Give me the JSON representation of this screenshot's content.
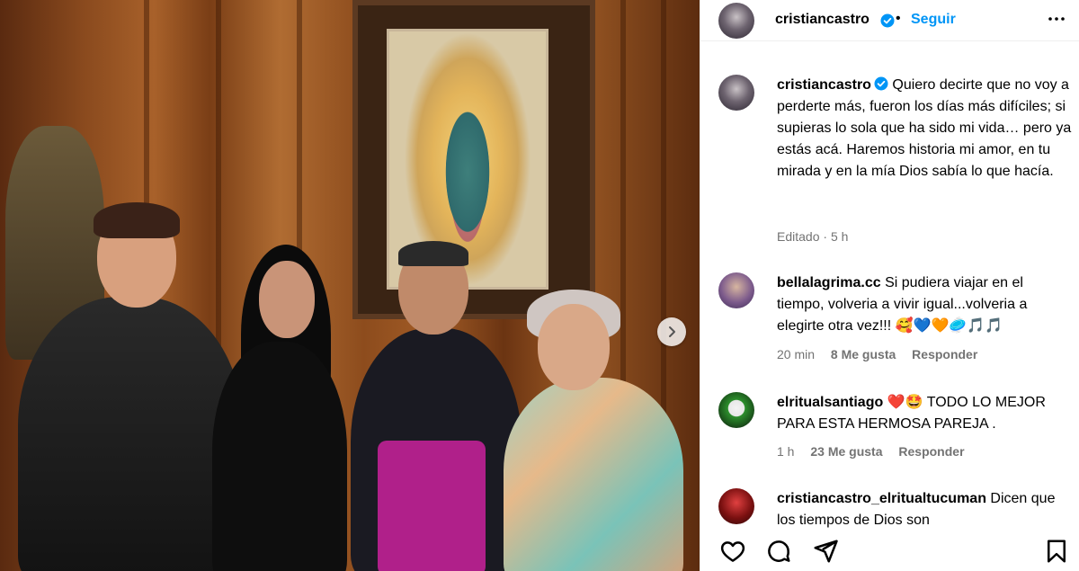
{
  "post_header": {
    "username": "cristiancastro",
    "separator": "•",
    "follow_label": "Seguir"
  },
  "caption": {
    "username": "cristiancastro",
    "text": "Quiero decirte que no voy a perderte más, fueron los días más difíciles; si supieras lo sola que ha sido mi vida… pero ya estás acá. Haremos historia mi amor, en tu mirada y en la mía Dios sabía lo que hacía.",
    "edited": "Editado",
    "time": "5 h"
  },
  "comments": [
    {
      "username": "bellalagrima.cc",
      "text": "Si pudiera viajar en el tiempo, volveria a vivir igual...volveria a elegirte otra vez!!! 🥰💙🧡🥏🎵🎵",
      "time": "20 min",
      "likes": "8 Me gusta",
      "reply": "Responder"
    },
    {
      "username": "elritualsantiago",
      "text": "❤️🤩 TODO LO MEJOR PARA ESTA HERMOSA PAREJA .",
      "time": "1 h",
      "likes": "23 Me gusta",
      "reply": "Responder"
    },
    {
      "username": "cristiancastro_elritualtucuman",
      "text": "Dicen que los tiempos de Dios son"
    }
  ],
  "icons": {
    "verified": "verified-badge-icon",
    "more": "more-options-icon",
    "next": "chevron-right-icon",
    "like": "heart-icon",
    "comment": "comment-icon",
    "share": "send-icon",
    "save": "bookmark-icon"
  },
  "colors": {
    "accent": "#0095f6",
    "muted": "#737373"
  }
}
